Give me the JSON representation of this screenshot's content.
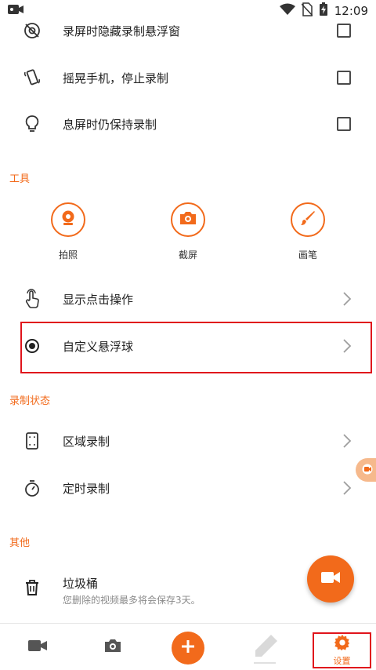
{
  "status_bar": {
    "time": "12:09"
  },
  "settings_rows": [
    {
      "label": "录屏时隐藏录制悬浮窗",
      "icon": "eye-off-icon",
      "checked": false
    },
    {
      "label": "摇晃手机，停止录制",
      "icon": "shake-phone-icon",
      "checked": false
    },
    {
      "label": "息屏时仍保持录制",
      "icon": "lightbulb-icon",
      "checked": false
    }
  ],
  "sections": {
    "tools": "工具",
    "record_status": "录制状态",
    "others": "其他"
  },
  "tools": [
    {
      "label": "拍照",
      "icon": "webcam-icon"
    },
    {
      "label": "截屏",
      "icon": "camera-icon"
    },
    {
      "label": "画笔",
      "icon": "brush-icon"
    }
  ],
  "nav_rows": [
    {
      "label": "显示点击操作",
      "icon": "tap-gesture-icon"
    },
    {
      "label": "自定义悬浮球",
      "icon": "radio-dot-icon"
    },
    {
      "label": "区域录制",
      "icon": "region-icon"
    },
    {
      "label": "定时录制",
      "icon": "timer-icon"
    }
  ],
  "trash": {
    "label": "垃圾桶",
    "description": "您删除的视频最多将会保存3天。"
  },
  "bottom_nav": {
    "settings_label": "设置"
  },
  "accent_color": "#f26a1b"
}
